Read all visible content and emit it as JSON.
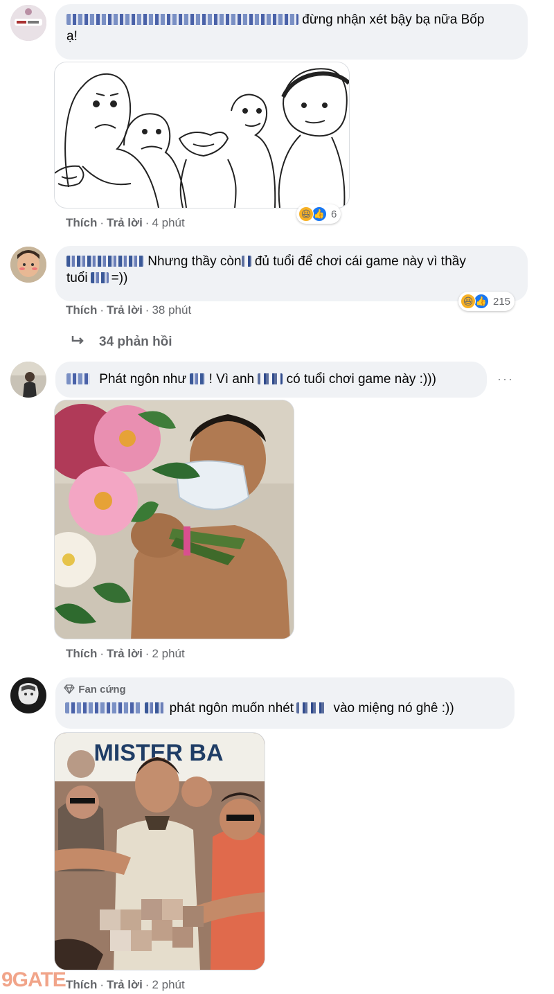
{
  "comments": [
    {
      "text_visible": "đừng nhận xét bậy bạ nữa Bốp",
      "text_line2": "ạ!",
      "actions": {
        "like": "Thích",
        "reply": "Trả lời",
        "time": "4 phút"
      },
      "reactions": {
        "count": "6"
      }
    },
    {
      "text_visible": "Nhưng thầy còn",
      "text_mid": "đủ tuổi để chơi cái game này vì thầy",
      "text_line2": "tuổi",
      "text_end": "=))",
      "actions": {
        "like": "Thích",
        "reply": "Trả lời",
        "time": "38 phút"
      },
      "reactions": {
        "count": "215"
      },
      "replies_label": "34 phản hồi"
    },
    {
      "text_a": "Phát ngôn như",
      "text_b": "! Vì anh",
      "text_c": "có tuổi chơi game này :)))",
      "more": "···",
      "actions": {
        "like": "Thích",
        "reply": "Trả lời",
        "time": "2 phút"
      }
    },
    {
      "badge": "Fan cứng",
      "text_a": "phát ngôn muốn nhét",
      "text_b": "vào miệng nó ghê :))",
      "image_text": "MISTER BA",
      "actions": {
        "like": "Thích",
        "reply": "Trả lời",
        "time": "2 phút"
      }
    }
  ],
  "watermark": "9GATE",
  "icons": [
    "haha-icon",
    "like-icon",
    "reply-arrow-icon",
    "diamond-icon",
    "more-icon"
  ],
  "colors": {
    "bubble": "#f0f2f5",
    "meta": "#65676b",
    "like_blue": "#1877f2",
    "haha": "#f7b125"
  }
}
